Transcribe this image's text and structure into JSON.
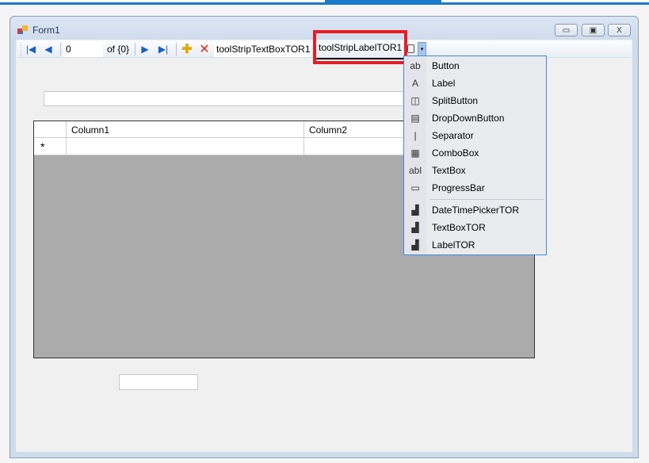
{
  "window": {
    "title": "Form1",
    "minimize": "▭",
    "maximize": "▣",
    "close": "X"
  },
  "toolstrip": {
    "position": "0",
    "count": "of {0}",
    "textbox_tor": "toolStripTextBoxTOR1",
    "label_tor": "toolStripLabelTOR1",
    "dropdown_arrow": "▾"
  },
  "grid": {
    "columns": [
      "Column1",
      "Column2"
    ],
    "new_row_marker": "*"
  },
  "menu": {
    "items": [
      {
        "label": "Button",
        "icon": "button-icon",
        "glyph": "ab"
      },
      {
        "label": "Label",
        "icon": "label-icon",
        "glyph": "A"
      },
      {
        "label": "SplitButton",
        "icon": "split-button-icon",
        "glyph": "◫"
      },
      {
        "label": "DropDownButton",
        "icon": "dropdown-button-icon",
        "glyph": "▤"
      },
      {
        "label": "Separator",
        "icon": "separator-icon",
        "glyph": "|"
      },
      {
        "label": "ComboBox",
        "icon": "combobox-icon",
        "glyph": "▦"
      },
      {
        "label": "TextBox",
        "icon": "textbox-icon",
        "glyph": "abl"
      },
      {
        "label": "ProgressBar",
        "icon": "progressbar-icon",
        "glyph": "▭"
      },
      {
        "label": "DateTimePickerTOR",
        "icon": "custom-control-icon",
        "glyph": "▟"
      },
      {
        "label": "TextBoxTOR",
        "icon": "custom-control-icon",
        "glyph": "▟"
      },
      {
        "label": "LabelTOR",
        "icon": "custom-control-icon",
        "glyph": "▟"
      }
    ]
  },
  "colors": {
    "highlight": "#e81c24",
    "accent": "#1979ca"
  }
}
